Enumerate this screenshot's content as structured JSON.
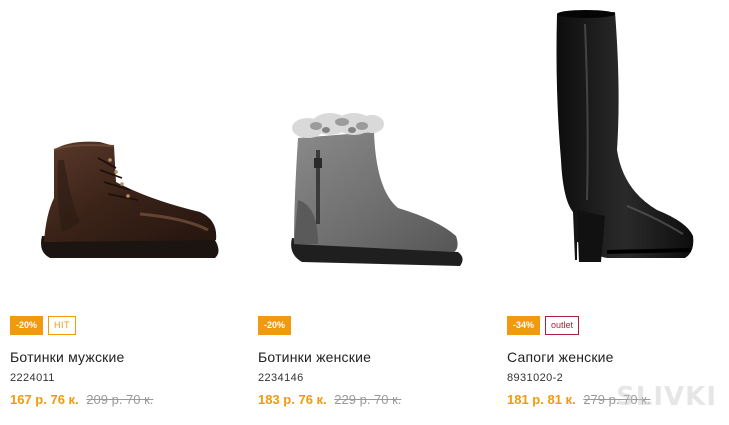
{
  "products": [
    {
      "badges": [
        {
          "type": "discount",
          "label": "-20%"
        },
        {
          "type": "hit",
          "label": "HIT"
        }
      ],
      "title": "Ботинки мужские",
      "sku": "2224011",
      "price_new": "167 р. 76 к.",
      "price_old": "209 р. 70 к.",
      "image_icon": "mens-leather-boot-icon"
    },
    {
      "badges": [
        {
          "type": "discount",
          "label": "-20%"
        }
      ],
      "title": "Ботинки женские",
      "sku": "2234146",
      "price_new": "183 р. 76 к.",
      "price_old": "229 р. 70 к.",
      "image_icon": "womens-fur-ankle-boot-icon"
    },
    {
      "badges": [
        {
          "type": "discount",
          "label": "-34%"
        },
        {
          "type": "outlet",
          "label": "outlet"
        }
      ],
      "title": "Сапоги женские",
      "sku": "8931020-2",
      "price_new": "181 р. 81 к.",
      "price_old": "279 р. 70 к.",
      "image_icon": "womens-knee-high-boot-icon"
    }
  ],
  "watermark": "SLIVKI",
  "colors": {
    "accent": "#f29a0f",
    "outlet": "#b21e3a",
    "old_price": "#999999"
  }
}
